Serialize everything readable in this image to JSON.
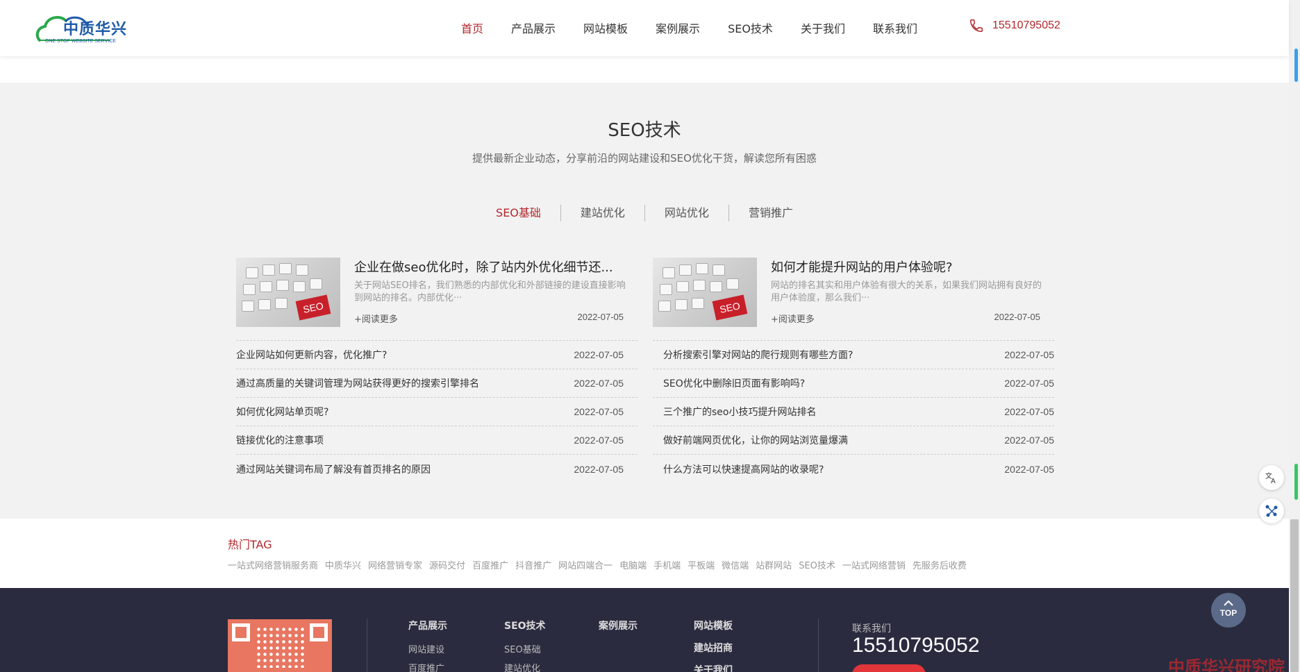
{
  "header": {
    "logo_text": "中质华兴",
    "logo_sub": "ONE STOP WEBSITE SERVICE",
    "nav": [
      "首页",
      "产品展示",
      "网站模板",
      "案例展示",
      "SEO技术",
      "关于我们",
      "联系我们"
    ],
    "phone": "15510795052"
  },
  "section": {
    "title": "SEO技术",
    "subtitle": "提供最新企业动态，分享前沿的网站建设和SEO优化干货，解读您所有困惑",
    "tabs": [
      "SEO基础",
      "建站优化",
      "网站优化",
      "营销推广"
    ],
    "left": {
      "feature": {
        "title": "企业在做seo优化时，除了站内外优化细节还...",
        "desc": "关于网站SEO排名，我们熟悉的内部优化和外部链接的建设直接影响到网站的排名。内部优化···",
        "more": "+阅读更多",
        "date": "2022-07-05",
        "thumb_label": "SEO"
      },
      "items": [
        {
          "title": "企业网站如何更新内容，优化推广?",
          "date": "2022-07-05"
        },
        {
          "title": "通过高质量的关键词管理为网站获得更好的搜索引擎排名",
          "date": "2022-07-05"
        },
        {
          "title": "如何优化网站单页呢?",
          "date": "2022-07-05"
        },
        {
          "title": "链接优化的注意事项",
          "date": "2022-07-05"
        },
        {
          "title": "通过网站关键词布局了解没有首页排名的原因",
          "date": "2022-07-05"
        }
      ]
    },
    "right": {
      "feature": {
        "title": "如何才能提升网站的用户体验呢?",
        "desc": "网站的排名其实和用户体验有很大的关系，如果我们网站拥有良好的用户体验度，那么我们···",
        "more": "+阅读更多",
        "date": "2022-07-05",
        "thumb_label": "SEO"
      },
      "items": [
        {
          "title": "分析搜索引擎对网站的爬行规则有哪些方面?",
          "date": "2022-07-05"
        },
        {
          "title": "SEO优化中删除旧页面有影响吗?",
          "date": "2022-07-05"
        },
        {
          "title": "三个推广的seo小技巧提升网站排名",
          "date": "2022-07-05"
        },
        {
          "title": "做好前端网页优化，让你的网站浏览量爆满",
          "date": "2022-07-05"
        },
        {
          "title": "什么方法可以快速提高网站的收录呢?",
          "date": "2022-07-05"
        }
      ]
    }
  },
  "tags": {
    "title": "热门TAG",
    "list": [
      "一站式网络营销服务商",
      "中质华兴",
      "网络营销专家",
      "源码交付",
      "百度推广",
      "抖音推广",
      "网站四端合一",
      "电脑端",
      "手机端",
      "平板端",
      "微信端",
      "站群网站",
      "SEO技术",
      "一站式网络营销",
      "先服务后收费"
    ]
  },
  "footer": {
    "col1": {
      "head": "产品展示",
      "links": [
        "网站建设",
        "百度推广"
      ]
    },
    "col2": {
      "head": "SEO技术",
      "links": [
        "SEO基础",
        "建站优化"
      ]
    },
    "col3": {
      "head": "案例展示"
    },
    "col4": {
      "heads": [
        "网站模板",
        "建站招商",
        "关于我们"
      ]
    },
    "contact_label": "联系我们",
    "contact_phone": "15510795052",
    "watermark": "中质华兴研究院"
  },
  "top_button": "TOP",
  "colors": {
    "accent": "#b3262c",
    "footer_bg": "#2a2b3f",
    "section_bg": "#f2f2f2"
  }
}
